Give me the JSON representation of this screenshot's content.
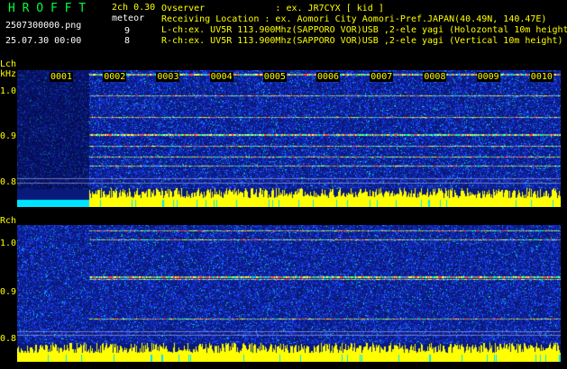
{
  "header": {
    "brand": "H R O F F T",
    "channel_mode": "2ch 0.30",
    "event_type": "meteor",
    "filename": "2507300000.png",
    "datetime": "25.07.30 00:00",
    "count_l": "9",
    "count_r": "8",
    "observer_line": "Ovserver             : ex. JR7CYX [ kid ]",
    "location_line": "Receiving Location : ex. Aomori City Aomori-Pref.JAPAN(40.49N, 140.47E)",
    "lch_line": "L-ch:ex. UV5R 113.900Mhz(SAPPORO VOR)USB ,2-ele yagi (Holozontal 10m height",
    "rch_line": "R-ch:ex. UV5R 113.900Mhz(SAPPORO VOR)USB ,2-ele yagi (Vertical 10m height)"
  },
  "lch": {
    "label": "Lch",
    "unit": "kHz",
    "ticks": [
      "1.0",
      "0.9",
      "0.8"
    ],
    "minutes": [
      "0001",
      "0002",
      "0003",
      "0004",
      "0005",
      "0006",
      "0007",
      "0008",
      "0009",
      "0010"
    ]
  },
  "rch": {
    "label": "Rch",
    "ticks": [
      "1.0",
      "0.9",
      "0.8"
    ]
  },
  "colors": {
    "background": "#000000",
    "header_green": "#00ff3a",
    "text_yellow": "#ffff00",
    "noise_blue": "#1a3cff",
    "signal_yellow": "#ffff00",
    "cyan": "#00e5ff"
  }
}
